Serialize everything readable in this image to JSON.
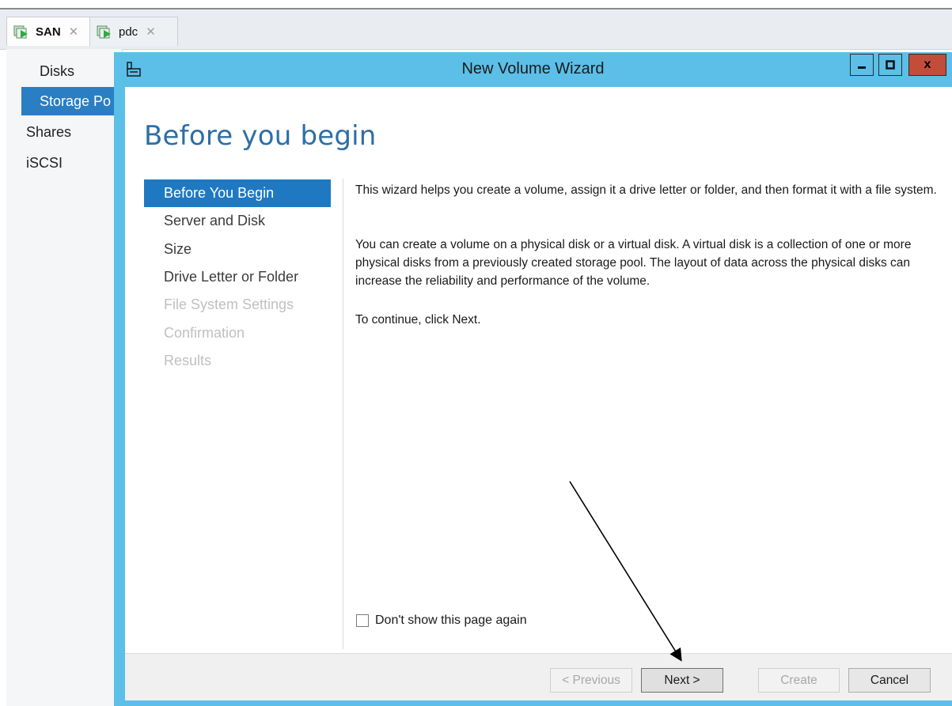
{
  "host_tabs": [
    {
      "label": "SAN",
      "icon": "vm-icon",
      "close": "✕"
    },
    {
      "label": "pdc",
      "icon": "vm-icon",
      "close": "✕"
    }
  ],
  "left_nav": {
    "items": [
      {
        "label": "Disks"
      },
      {
        "label": "Storage Po"
      },
      {
        "label": "Shares"
      },
      {
        "label": "iSCSI"
      }
    ]
  },
  "wizard": {
    "title": "New Volume Wizard",
    "page_title": "Before you begin",
    "steps": [
      {
        "label": "Before You Begin",
        "state": "current"
      },
      {
        "label": "Server and Disk",
        "state": "enabled"
      },
      {
        "label": "Size",
        "state": "enabled"
      },
      {
        "label": "Drive Letter or Folder",
        "state": "enabled"
      },
      {
        "label": "File System Settings",
        "state": "disabled"
      },
      {
        "label": "Confirmation",
        "state": "disabled"
      },
      {
        "label": "Results",
        "state": "disabled"
      }
    ],
    "paragraphs": [
      "This wizard helps you create a volume, assign it a drive letter or folder, and then format it with a file system.",
      "You can create a volume on a physical disk or a virtual disk. A virtual disk is a collection of one or more physical disks from a previously created storage pool. The layout of data across the physical disks can increase the reliability and performance of the volume.",
      "To continue, click Next."
    ],
    "dont_show_label": "Don't show this page again",
    "dont_show_checked": false,
    "buttons": {
      "previous": "< Previous",
      "next": "Next >",
      "create": "Create",
      "cancel": "Cancel"
    },
    "window_controls": {
      "close": "x"
    }
  },
  "colors": {
    "titlebar": "#5bbfe8",
    "accent": "#1e79c2",
    "heading": "#2e6ea6",
    "close_button": "#c24d3b"
  }
}
